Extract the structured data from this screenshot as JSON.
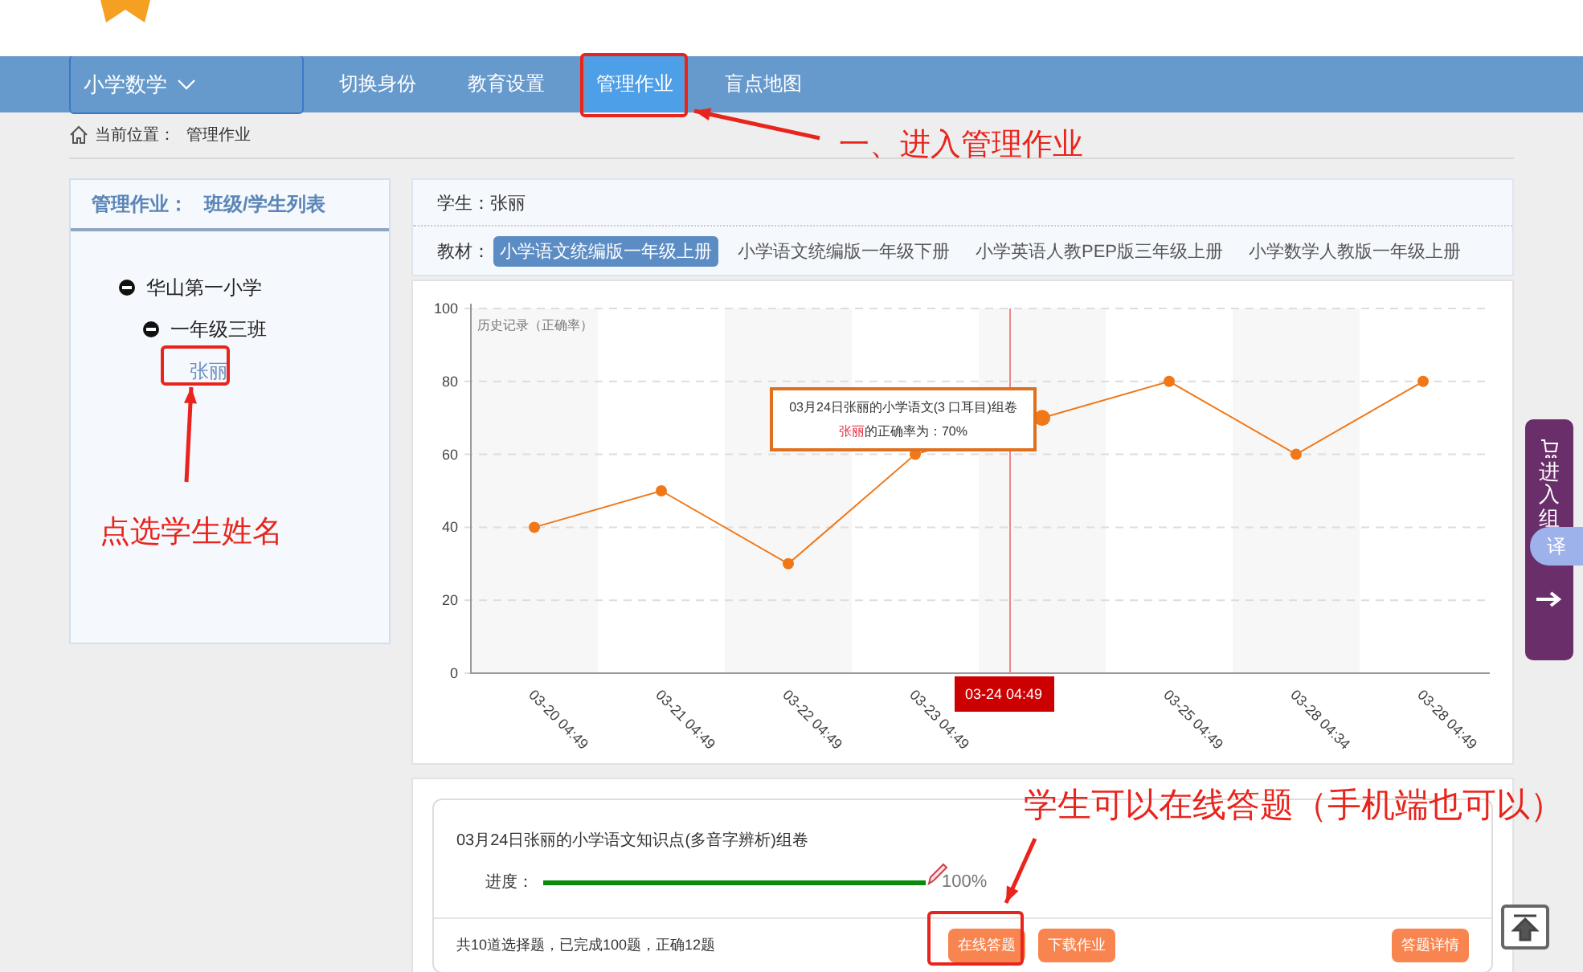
{
  "subject_menu": {
    "label": "小学数学"
  },
  "nav": [
    {
      "label": "切换身份",
      "selected": false
    },
    {
      "label": "教育设置",
      "selected": false
    },
    {
      "label": "管理作业",
      "selected": true
    },
    {
      "label": "盲点地图",
      "selected": false
    }
  ],
  "breadcrumb": {
    "label": "当前位置：",
    "page": "管理作业"
  },
  "sidebar": {
    "title": "管理作业：",
    "subtitle": "班级/学生列表",
    "tree": [
      {
        "label": "华山第一小学",
        "expanded": true,
        "children": [
          {
            "label": "一年级三班",
            "expanded": true,
            "children": [
              {
                "label": "张丽",
                "selected": true
              }
            ]
          }
        ]
      }
    ]
  },
  "student": {
    "label": "学生：",
    "name": "张丽"
  },
  "textbooks": {
    "label": "教材：",
    "items": [
      {
        "label": "小学语文统编版一年级上册",
        "selected": true
      },
      {
        "label": "小学语文统编版一年级下册",
        "selected": false
      },
      {
        "label": "小学英语人教PEP版三年级上册",
        "selected": false
      },
      {
        "label": "小学数学人教版一年级上册",
        "selected": false
      }
    ]
  },
  "chart_data": {
    "type": "line",
    "title": "历史记录（正确率）",
    "categories": [
      "03-20 04:49",
      "03-21 04:49",
      "03-22 04:49",
      "03-23 04:49",
      "03-24 04:49",
      "03-25 04:49",
      "03-28 04:34",
      "03-28 04:49"
    ],
    "series": [
      {
        "color": "#f07818",
        "marker": "circle",
        "values": [
          40,
          50,
          30,
          60,
          70,
          80,
          60,
          80
        ]
      }
    ],
    "ylim": [
      0,
      100
    ],
    "yticks": [
      0,
      20,
      40,
      60,
      80,
      100
    ],
    "grid": true,
    "ref_lines": [
      {
        "axis": "x",
        "value": "03-24 04:49"
      }
    ]
  },
  "tooltip": {
    "title": "03月24日张丽的小学语文(3 口耳目)组卷",
    "name": "张丽",
    "text": "的正确率为：70%"
  },
  "assignment": {
    "title": "03月24日张丽的小学语文知识点(多音字辨析)组卷",
    "progress_label": "进度：",
    "level": 1,
    "reading": "100%",
    "summary": "共10道选择题，已完成100题，正确12题",
    "buttons": [
      {
        "label": "在线答题",
        "kind": "left"
      },
      {
        "label": "下载作业",
        "kind": "left"
      },
      {
        "label": "答题详情",
        "kind": "right"
      }
    ]
  },
  "side_tab": {
    "label": "进入组",
    "bubble": "译"
  },
  "annotations": [
    {
      "text": "一、进入管理作业"
    },
    {
      "text": "点选学生姓名"
    },
    {
      "text": "学生可以在线答题（手机端也可以）"
    }
  ]
}
